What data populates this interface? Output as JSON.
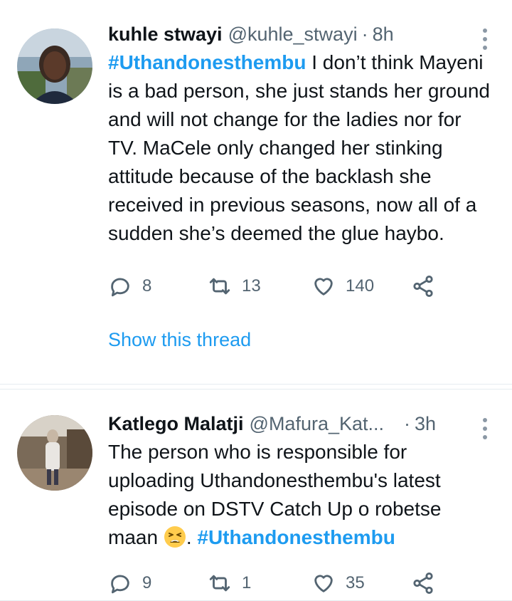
{
  "tweets": [
    {
      "name": "kuhle stwayi",
      "handle": "@kuhle_stwayi",
      "separator": "·",
      "time": "8h",
      "hashtag_start": "#Uthandonesthembu",
      "text": " I don’t think Mayeni is a bad person, she just stands her ground and will not change for the ladies nor for TV. MaCele only changed her stinking attitude because of the backlash she received in previous seasons, now all of a sudden she’s deemed the glue haybo.",
      "replies": "8",
      "retweets": "13",
      "likes": "140",
      "show_thread": "Show this thread"
    },
    {
      "name": "Katlego Malatji",
      "handle": "@Mafura_Kat...",
      "separator": "·",
      "time": "3h",
      "text": "The person who is responsible for uploading Uthandonesthembu's latest episode on DSTV Catch Up o robetse maan ",
      "text_after_emoji": ". ",
      "hashtag_end": "#Uthandonesthembu",
      "emoji": "tired-face-emoji",
      "replies": "9",
      "retweets": "1",
      "likes": "35"
    }
  ],
  "icons": {
    "reply": "reply-icon",
    "retweet": "retweet-icon",
    "like": "heart-icon",
    "share": "share-icon",
    "more": "more-vertical-icon"
  },
  "colors": {
    "accent": "#1d9bf0",
    "secondary_text": "#536471",
    "primary_text": "#0f1419"
  }
}
